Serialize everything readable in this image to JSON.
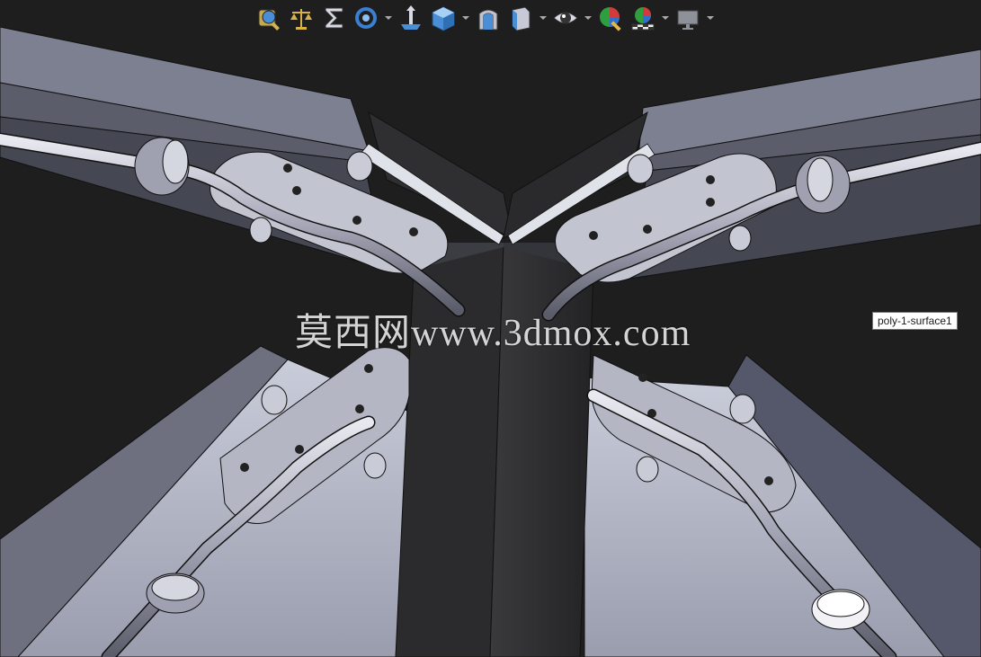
{
  "viewport": {
    "background": "#1e1e1e",
    "model_colors": {
      "frame_light": "#b9bccb",
      "frame_dark": "#5f6171",
      "post": "#2c2c2e",
      "metal": "#c9cbd6"
    }
  },
  "heads_up_toolbar": {
    "buttons": [
      {
        "icon": "zoom-to-fit-icon",
        "has_dropdown": false
      },
      {
        "icon": "mass-properties-icon",
        "has_dropdown": false
      },
      {
        "icon": "sum-icon",
        "has_dropdown": false
      },
      {
        "icon": "rotate-view-icon",
        "has_dropdown": true
      },
      {
        "icon": "section-view-icon",
        "has_dropdown": false
      },
      {
        "icon": "view-orientation-icon",
        "has_dropdown": true
      },
      {
        "icon": "display-style-icon",
        "has_dropdown": false
      },
      {
        "icon": "section-view-cube-icon",
        "has_dropdown": true
      },
      {
        "icon": "hide-show-items-icon",
        "has_dropdown": true
      },
      {
        "icon": "edit-appearance-icon",
        "has_dropdown": false
      },
      {
        "icon": "apply-scene-icon",
        "has_dropdown": true
      },
      {
        "icon": "view-settings-icon",
        "has_dropdown": true
      }
    ]
  },
  "tooltip": {
    "text": "poly-1-surface1"
  },
  "watermark": {
    "text": "莫西网www.3dmox.com"
  }
}
